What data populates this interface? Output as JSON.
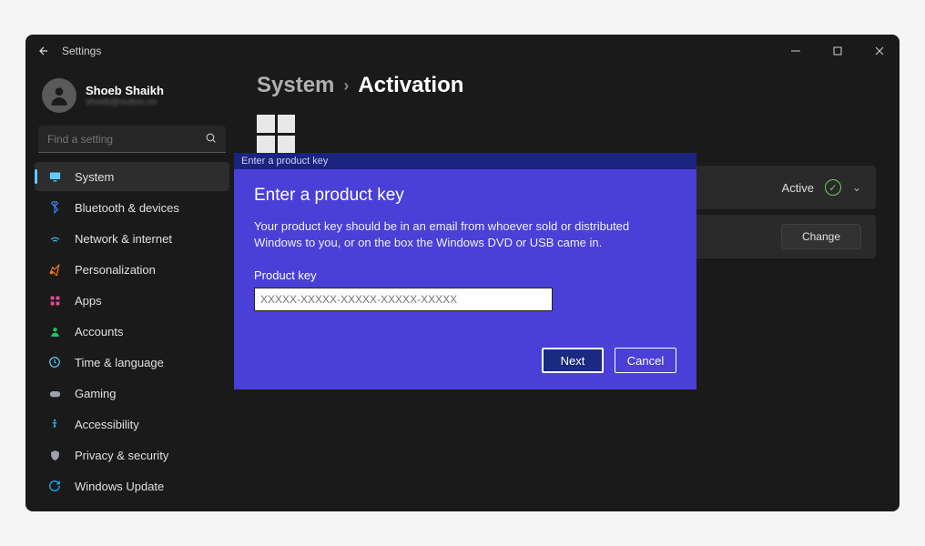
{
  "app_title": "Settings",
  "user": {
    "name": "Shoeb Shaikh",
    "email": "shoeb@outloo.co"
  },
  "search": {
    "placeholder": "Find a setting"
  },
  "sidebar": {
    "items": [
      {
        "label": "System",
        "active": true,
        "icon": "monitor",
        "color": "#60cdff"
      },
      {
        "label": "Bluetooth & devices",
        "active": false,
        "icon": "bluetooth",
        "color": "#3b82f6"
      },
      {
        "label": "Network & internet",
        "active": false,
        "icon": "wifi",
        "color": "#38bdf8"
      },
      {
        "label": "Personalization",
        "active": false,
        "icon": "brush",
        "color": "#f97316"
      },
      {
        "label": "Apps",
        "active": false,
        "icon": "grid",
        "color": "#ec4899"
      },
      {
        "label": "Accounts",
        "active": false,
        "icon": "person",
        "color": "#22c55e"
      },
      {
        "label": "Time & language",
        "active": false,
        "icon": "clock",
        "color": "#60cdff"
      },
      {
        "label": "Gaming",
        "active": false,
        "icon": "gamepad",
        "color": "#9ca3af"
      },
      {
        "label": "Accessibility",
        "active": false,
        "icon": "accessibility",
        "color": "#38bdf8"
      },
      {
        "label": "Privacy & security",
        "active": false,
        "icon": "shield",
        "color": "#9ca3af"
      },
      {
        "label": "Windows Update",
        "active": false,
        "icon": "update",
        "color": "#0ea5e9"
      }
    ]
  },
  "breadcrumb": {
    "parent": "System",
    "current": "Activation"
  },
  "activation": {
    "status_label": "Active",
    "change_button": "Change"
  },
  "dialog": {
    "titlebar": "Enter a product key",
    "heading": "Enter a product key",
    "body": "Your product key should be in an email from whoever sold or distributed Windows to you, or on the box the Windows DVD or USB came in.",
    "field_label": "Product key",
    "placeholder": "XXXXX-XXXXX-XXXXX-XXXXX-XXXXX",
    "next": "Next",
    "cancel": "Cancel"
  }
}
